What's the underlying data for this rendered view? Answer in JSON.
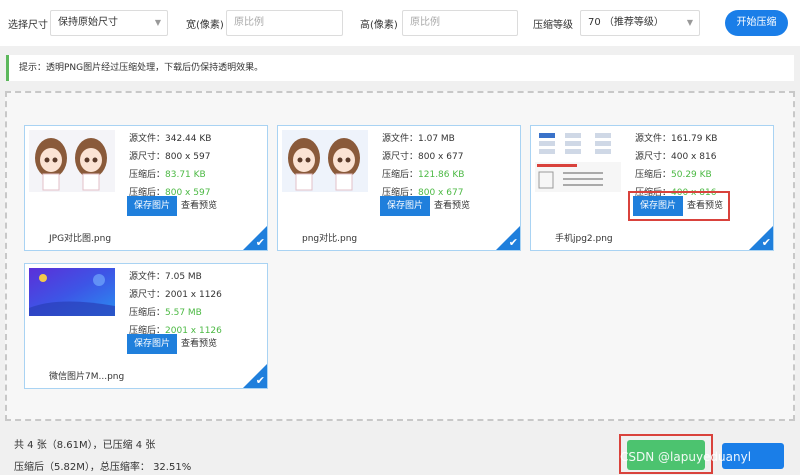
{
  "toolbar": {
    "size_label": "选择尺寸",
    "size_value": "保持原始尺寸",
    "width_label": "宽(像素)",
    "width_placeholder": "原比例",
    "height_label": "高(像素)",
    "height_placeholder": "原比例",
    "level_label": "压缩等级",
    "level_value": "70 （推荐等级）",
    "start_button": "开始压缩"
  },
  "tip": "提示：透明PNG图片经过压缩处理，下载后仍保持透明效果。",
  "labels": {
    "source_file": "源文件：",
    "source_size": "源尺寸：",
    "compressed": "压缩后：",
    "save_button": "保存图片",
    "preview": "查看预览"
  },
  "files": [
    {
      "name": "JPG对比图.png",
      "source_file": "342.44 KB",
      "source_dims": "800 x 597",
      "compressed_file": "83.71 KB",
      "compressed_dims": "800 x 597"
    },
    {
      "name": "png对比.png",
      "source_file": "1.07 MB",
      "source_dims": "800 x 677",
      "compressed_file": "121.86 KB",
      "compressed_dims": "800 x 677"
    },
    {
      "name": "手机jpg2.png",
      "source_file": "161.79 KB",
      "source_dims": "400 x 816",
      "compressed_file": "50.29 KB",
      "compressed_dims": "400 x 816"
    },
    {
      "name": "微信图片7M...png",
      "source_file": "7.05 MB",
      "source_dims": "2001 x 1126",
      "compressed_file": "5.57 MB",
      "compressed_dims": "2001 x 1126"
    }
  ],
  "summary": {
    "line1": "共 4 张（8.61M），已压缩 4 张",
    "line2": "压缩后（5.82M），总压缩率： 32.51%"
  },
  "watermark": "CSDN @lapuyeduanyl",
  "colors": {
    "accent": "#1f7fdc",
    "green": "#4cb944",
    "highlight": "#d9423c"
  }
}
